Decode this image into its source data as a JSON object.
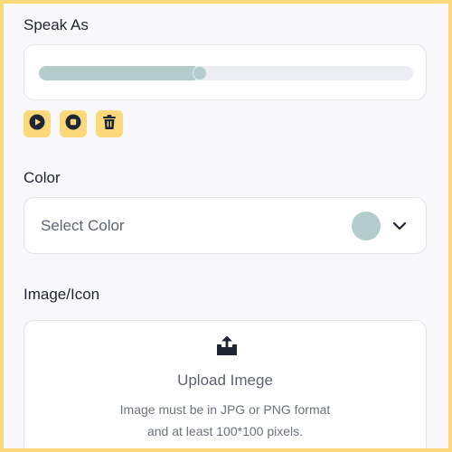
{
  "speak_as": {
    "label": "Speak As",
    "progress": 0.43,
    "controls": [
      {
        "name": "play-icon"
      },
      {
        "name": "stop-icon"
      },
      {
        "name": "trash-icon"
      }
    ]
  },
  "color": {
    "label": "Color",
    "placeholder": "Select Color",
    "swatch": "#b4cccc",
    "chevron_icon": "chevron-down-icon"
  },
  "image_icon": {
    "label": "Image/Icon",
    "icon": "upload-icon",
    "upload_label": "Upload Imege",
    "hint_line_1": "Image must be in JPG or PNG format",
    "hint_line_2": "and at least 100*100 pixels."
  },
  "colors": {
    "accent_yellow": "#fbd87a",
    "slider_fill": "#b4cccc",
    "icon_dark": "#1f2533"
  }
}
